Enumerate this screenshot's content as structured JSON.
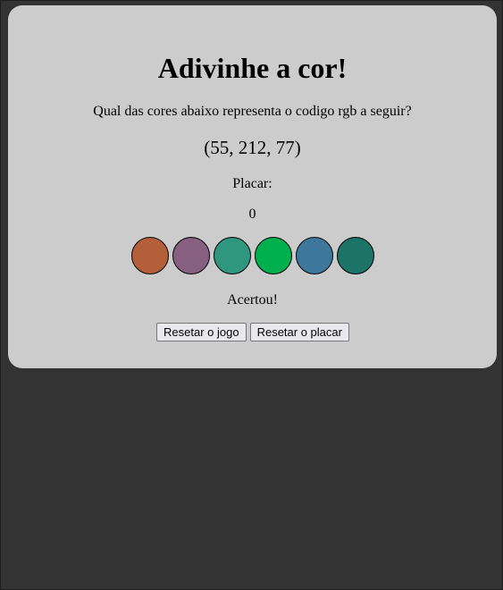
{
  "game": {
    "title": "Adivinhe a cor!",
    "question": "Qual das cores abaixo representa o codigo rgb a seguir?",
    "rgb_code": "(55, 212, 77)",
    "score_label": "Placar:",
    "score_value": "0",
    "answer_message": "Acertou!"
  },
  "balls": [
    {
      "name": "ball-1",
      "color": "#b35f39"
    },
    {
      "name": "ball-2",
      "color": "#875f80"
    },
    {
      "name": "ball-3",
      "color": "#2e977e"
    },
    {
      "name": "ball-4",
      "color": "#00b04f"
    },
    {
      "name": "ball-5",
      "color": "#3e779c"
    },
    {
      "name": "ball-6",
      "color": "#1c7467"
    }
  ],
  "buttons": {
    "reset_game": "Resetar o jogo",
    "reset_score": "Resetar o placar"
  },
  "colors": {
    "page_background": "#333333",
    "card_background": "#cccccc"
  }
}
